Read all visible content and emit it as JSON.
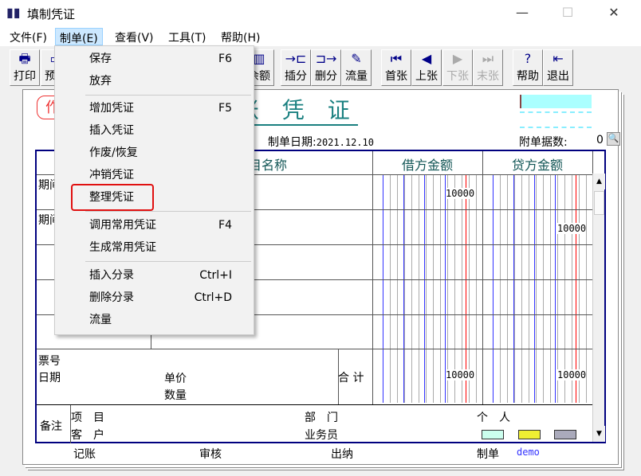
{
  "window": {
    "title": "填制凭证",
    "controls": {
      "minimize": "—",
      "maximize": "☐",
      "close": "✕"
    }
  },
  "menubar": [
    "文件(F)",
    "制单(E)",
    "查看(V)",
    "工具(T)",
    "帮助(H)"
  ],
  "toolbar": [
    {
      "label": "打印",
      "icon": "printer-icon",
      "glyph": "🖶"
    },
    {
      "label": "预览",
      "icon": "preview-icon",
      "glyph": "▭"
    },
    {
      "label": "余额",
      "icon": "balance-chart-icon",
      "glyph": "▥"
    },
    {
      "label": "插分",
      "icon": "insert-entry-icon",
      "glyph": "→⊏"
    },
    {
      "label": "删分",
      "icon": "delete-entry-icon",
      "glyph": "⊐→"
    },
    {
      "label": "流量",
      "icon": "cash-flow-icon",
      "glyph": "✎"
    },
    {
      "label": "首张",
      "icon": "first-icon",
      "glyph": "⏮"
    },
    {
      "label": "上张",
      "icon": "previous-icon",
      "glyph": "◀"
    },
    {
      "label": "下张",
      "icon": "next-icon",
      "glyph": "▶",
      "disabled": true
    },
    {
      "label": "末张",
      "icon": "last-icon",
      "glyph": "⏭",
      "disabled": true
    },
    {
      "label": "帮助",
      "icon": "help-icon",
      "glyph": "?"
    },
    {
      "label": "退出",
      "icon": "exit-icon",
      "glyph": "⇤"
    }
  ],
  "menu": [
    {
      "label": "保存",
      "shortcut": "F6"
    },
    {
      "label": "放弃",
      "shortcut": ""
    },
    {
      "label": "增加凭证",
      "shortcut": "F5"
    },
    {
      "label": "插入凭证",
      "shortcut": ""
    },
    {
      "label": "作废/恢复",
      "shortcut": ""
    },
    {
      "label": "冲销凭证",
      "shortcut": ""
    },
    {
      "label": "整理凭证",
      "shortcut": "",
      "highlighted": true
    },
    {
      "label": "调用常用凭证",
      "shortcut": "F4"
    },
    {
      "label": "生成常用凭证",
      "shortcut": ""
    },
    {
      "label": "插入分录",
      "shortcut": "Ctrl+I"
    },
    {
      "label": "删除分录",
      "shortcut": "Ctrl+D"
    },
    {
      "label": "流量",
      "shortcut": ""
    }
  ],
  "voucher": {
    "stamp": "作",
    "title": "记 账 凭 证",
    "date_label": "制单日期:",
    "date": "2021.12.10",
    "attachments_label": "附单据数:",
    "attachments": "0",
    "headers": {
      "account": "科目名称",
      "debit": "借方金额",
      "credit": "贷方金额"
    },
    "rows": [
      {
        "summary": "期间",
        "debit": "10000",
        "credit": ""
      },
      {
        "summary": "期间",
        "debit": "",
        "credit": "10000"
      }
    ],
    "totals": {
      "ticket": "票号",
      "date": "日期",
      "unit_price": "单价",
      "quantity": "数量",
      "label": "合 计",
      "debit": "10000",
      "credit": "10000"
    },
    "notes": {
      "label": "备注",
      "project": "项　目",
      "customer": "客　户",
      "department": "部　门",
      "salesperson": "业务员",
      "person": "个　人"
    },
    "footer": {
      "posting": "记账",
      "review": "审核",
      "cashier": "出纳",
      "maker": "制单",
      "maker_name": "demo"
    }
  },
  "colors": {
    "title": "#1a8080",
    "highlight": "#e01010",
    "table_border": "#00007f"
  }
}
